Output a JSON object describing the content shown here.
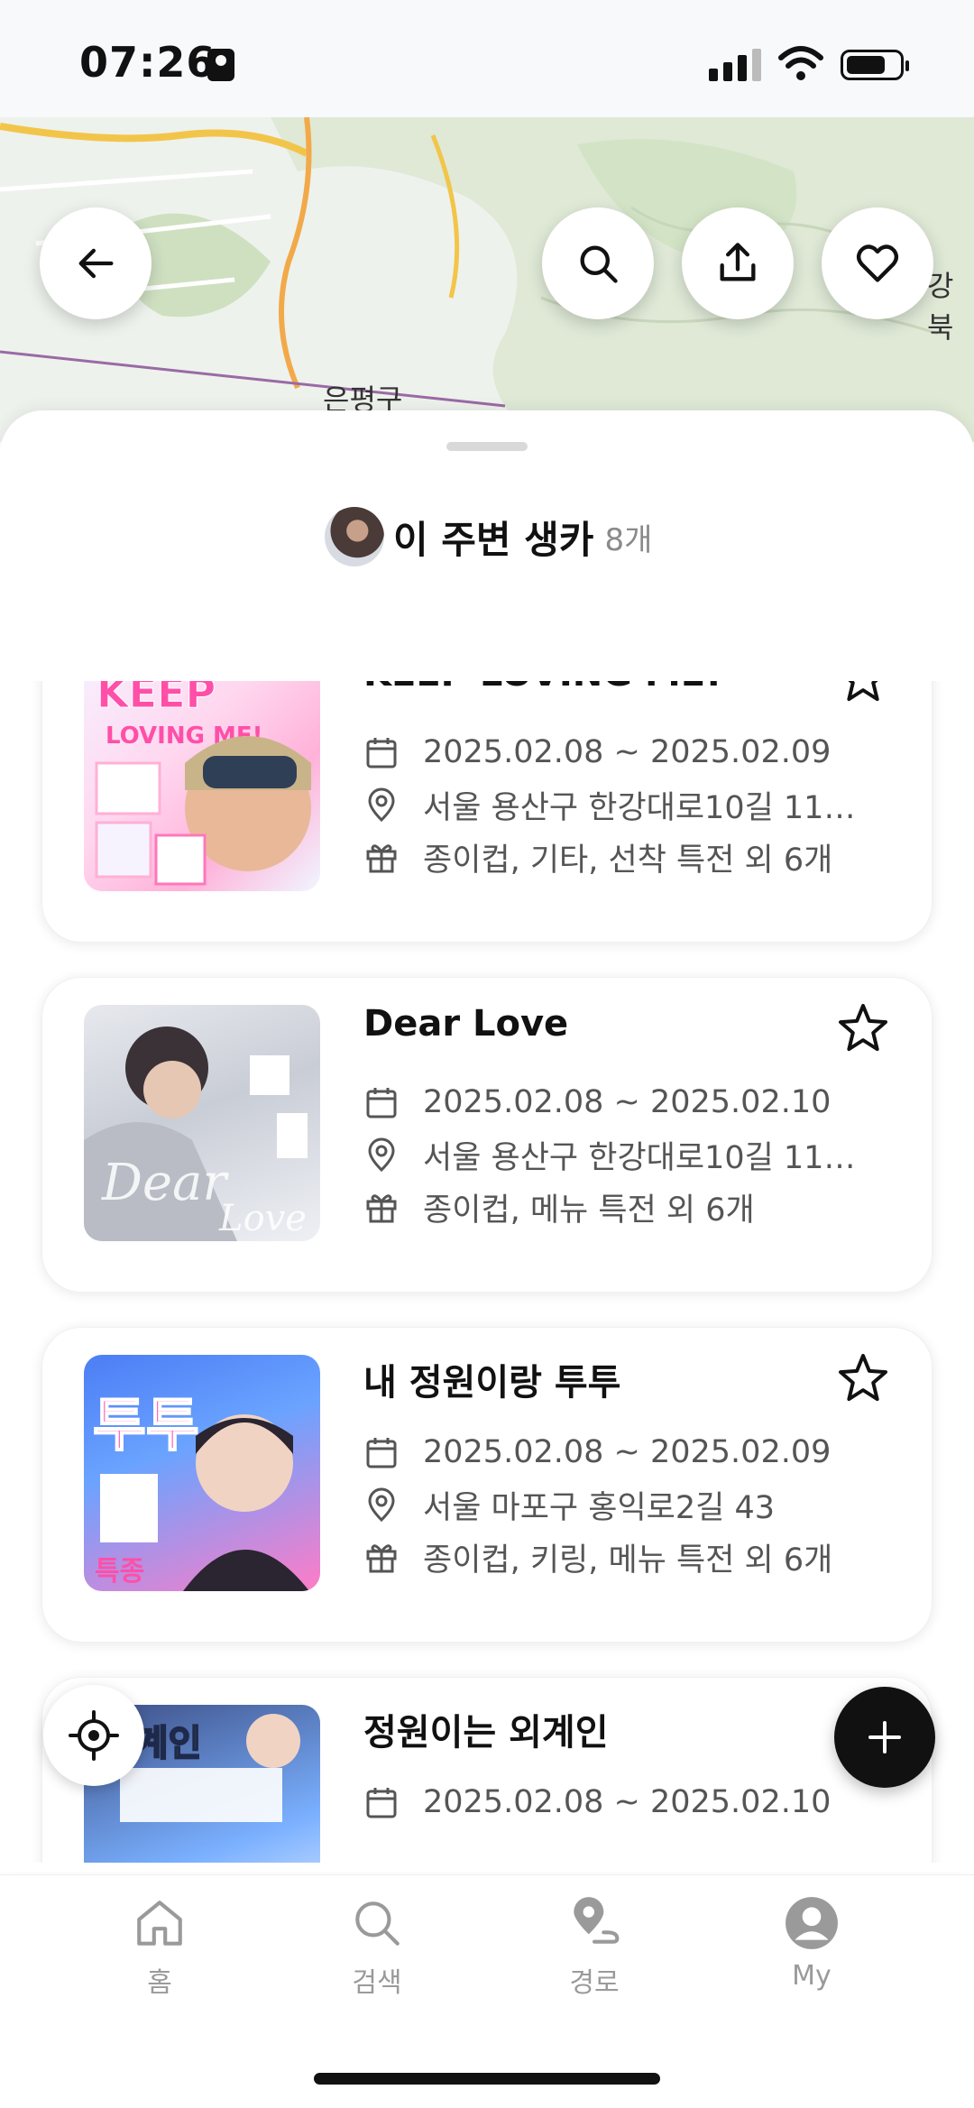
{
  "status_bar": {
    "time": "07:26",
    "icons": [
      "person-badge-icon",
      "cellular-signal-icon",
      "wifi-icon",
      "battery-icon"
    ]
  },
  "map": {
    "labels": [
      "은평구",
      "강북"
    ]
  },
  "top_buttons": {
    "back": "back-arrow-icon",
    "search": "search-icon",
    "share": "share-icon",
    "favorite": "heart-icon"
  },
  "sheet": {
    "title": "이 주변 생카",
    "count": "8개"
  },
  "cards": [
    {
      "title": "KEEP LOVING ME!",
      "date": "2025.02.08 ~ 2025.02.09",
      "address": "서울 용산구 한강대로10길 11…",
      "gifts": "종이컵, 기타, 선착 특전 외 6개"
    },
    {
      "title": "Dear Love",
      "date": "2025.02.08 ~ 2025.02.10",
      "address": "서울 용산구 한강대로10길 11…",
      "gifts": "종이컵, 메뉴 특전 외 6개"
    },
    {
      "title": "내 정원이랑 투투",
      "date": "2025.02.08 ~ 2025.02.09",
      "address": "서울 마포구 홍익로2길 43",
      "gifts": "종이컵, 키링, 메뉴 특전 외 6개"
    },
    {
      "title": "정원이는 외계인",
      "date": "2025.02.08 ~ 2025.02.10",
      "address": "",
      "gifts": ""
    }
  ],
  "bottom_nav": {
    "items": [
      {
        "label": "홈",
        "icon": "home-icon"
      },
      {
        "label": "검색",
        "icon": "search-icon"
      },
      {
        "label": "경로",
        "icon": "route-pin-icon"
      },
      {
        "label": "My",
        "icon": "profile-icon"
      }
    ]
  },
  "colors": {
    "accent_dark": "#111111",
    "muted_text": "#8a8a8a",
    "nav_inactive": "#9a9a9a"
  }
}
